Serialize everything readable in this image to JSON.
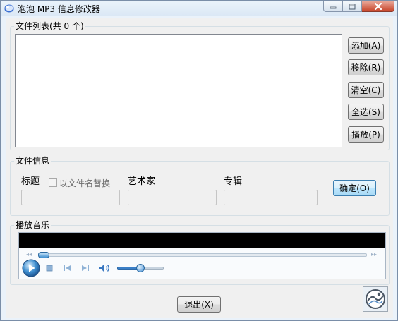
{
  "window": {
    "title": "泡泡 MP3 信息修改器"
  },
  "file_list": {
    "group_label": "文件列表(共 0 个)",
    "items": [],
    "buttons": {
      "add": "添加(A)",
      "remove": "移除(R)",
      "clear": "清空(C)",
      "select_all": "全选(S)",
      "play": "播放(P)"
    }
  },
  "file_info": {
    "group_label": "文件信息",
    "title_label": "标题",
    "use_filename_label": "以文件名替换",
    "use_filename_checked": false,
    "artist_label": "艺术家",
    "album_label": "专辑",
    "title_value": "",
    "artist_value": "",
    "album_value": "",
    "ok_button": "确定(O)"
  },
  "player": {
    "group_label": "播放音乐",
    "seek_position": 0.0,
    "volume_level": 0.5
  },
  "exit_button": "退出(X)",
  "colors": {
    "window_frame": "#7a8ea8",
    "title_bar": "#dbe8f5",
    "close_button": "#c7452a",
    "player_accent": "#3f8fd0"
  },
  "icons": {
    "app": "bubble-app-icon",
    "minimize": "minimize-icon",
    "maximize": "maximize-icon",
    "close": "close-icon",
    "play": "play-icon",
    "stop": "stop-icon",
    "previous": "previous-track-icon",
    "next": "next-track-icon",
    "volume": "speaker-icon",
    "logo": "app-logo-icon"
  }
}
